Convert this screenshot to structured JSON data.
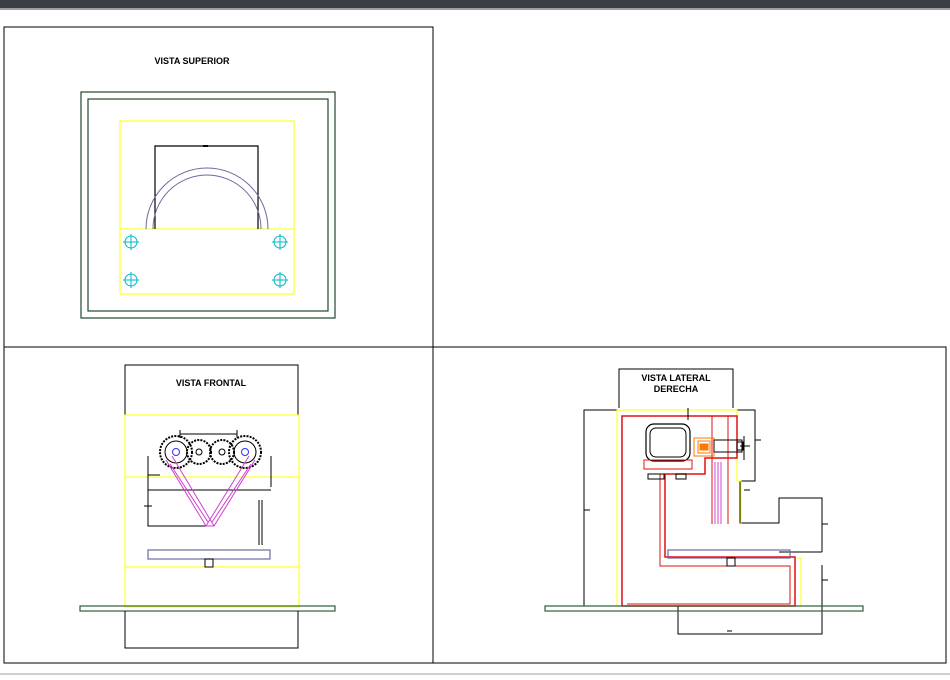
{
  "views": {
    "top": {
      "title": "VISTA SUPERIOR"
    },
    "front": {
      "title": "VISTA FRONTAL"
    },
    "side": {
      "title_line1": "VISTA LATERAL",
      "title_line2": "DERECHA"
    }
  },
  "colors": {
    "outline": "#000000",
    "frame": "#1f4a2a",
    "guide": "#ffff00",
    "hole": "#00b8c8",
    "part": "#6a6aa0",
    "linkage": "#d040d0",
    "structure": "#e01010",
    "accent": "#ff7a00",
    "base": "#2e5e3e"
  }
}
